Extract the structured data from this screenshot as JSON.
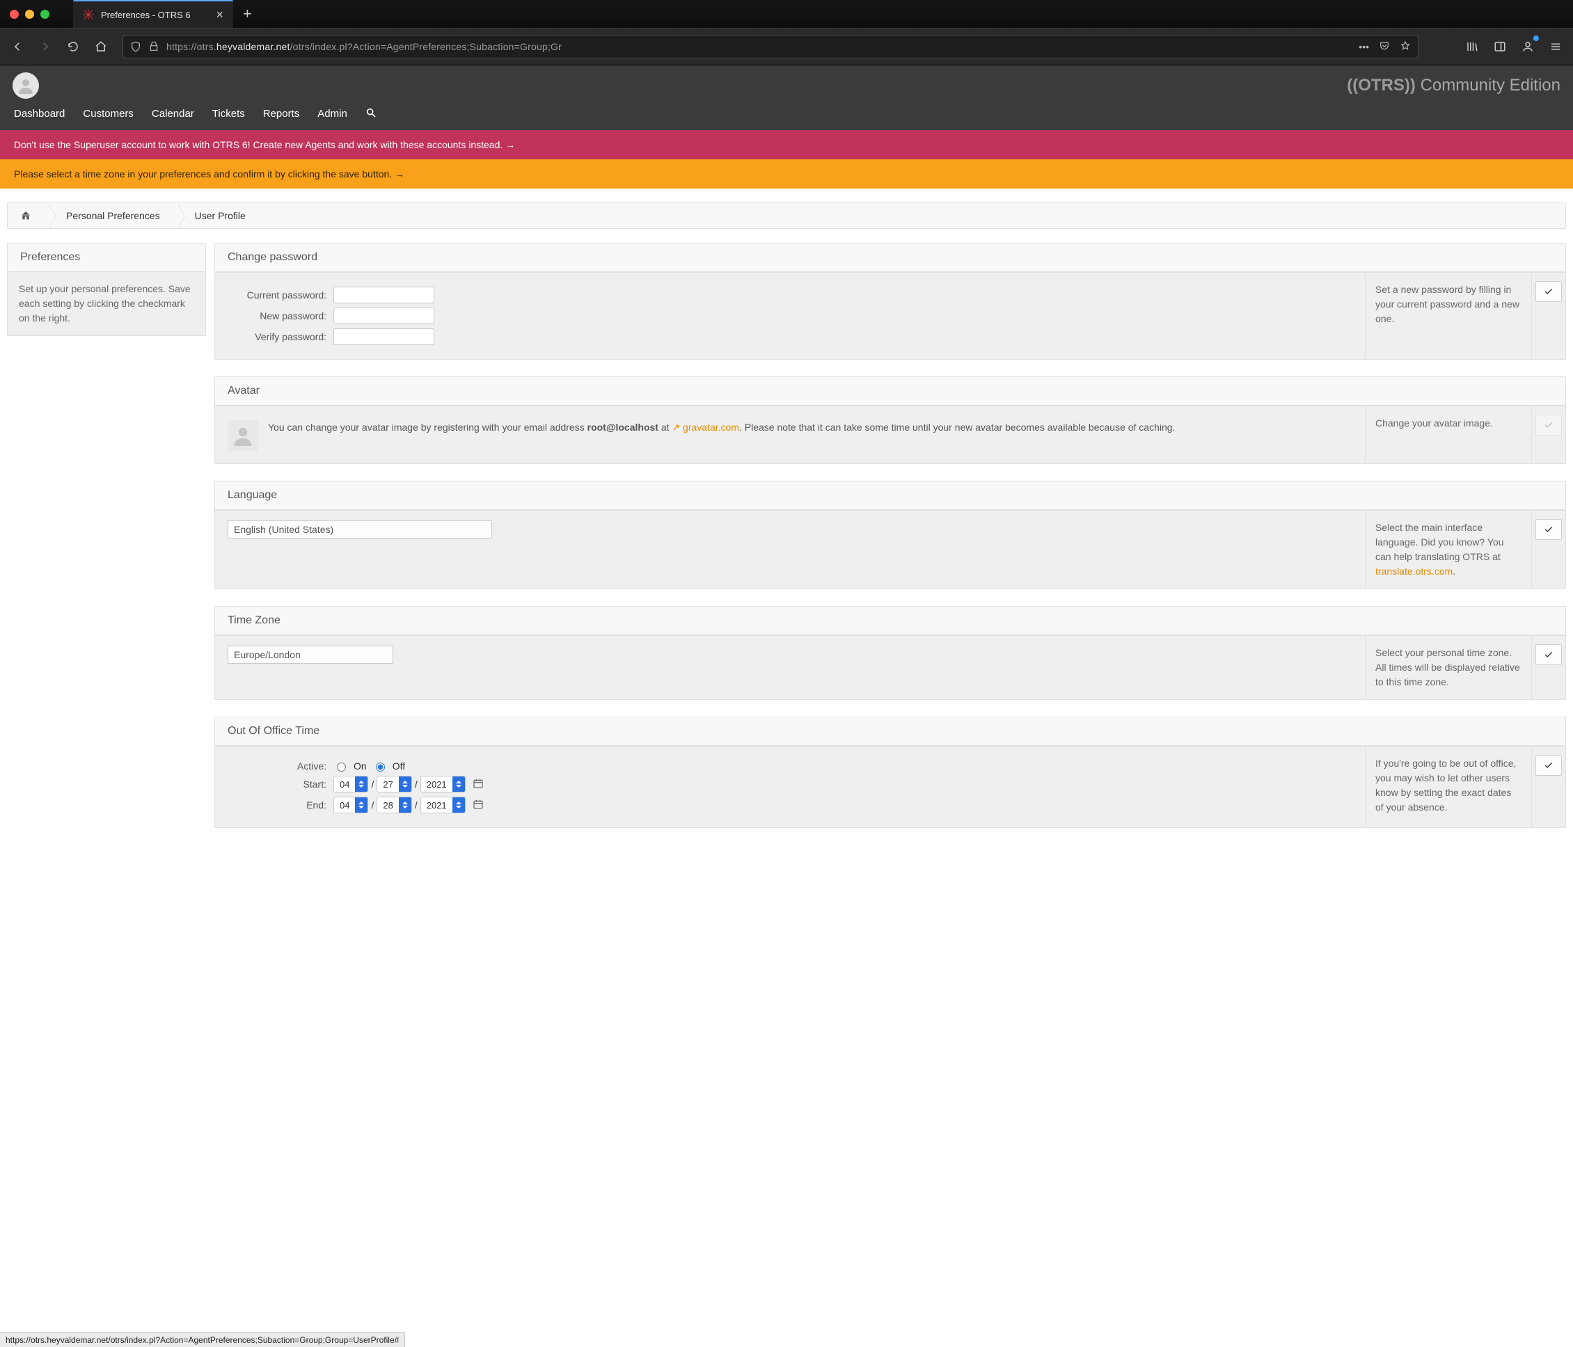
{
  "browser": {
    "tab_title": "Preferences - OTRS 6",
    "url_scheme": "https://otrs.",
    "url_host": "heyvaldemar.net",
    "url_path": "/otrs/index.pl?Action=AgentPreferences;Subaction=Group;Gr"
  },
  "brand": {
    "strong": "((OTRS))",
    "rest": " Community Edition"
  },
  "nav": {
    "items": [
      "Dashboard",
      "Customers",
      "Calendar",
      "Tickets",
      "Reports",
      "Admin"
    ]
  },
  "banners": {
    "red": "Don't use the Superuser account to work with OTRS 6! Create new Agents and work with these accounts instead. →",
    "orange": "Please select a time zone in your preferences and confirm it by clicking the save button. →"
  },
  "crumbs": {
    "a": "Personal Preferences",
    "b": "User Profile"
  },
  "side": {
    "title": "Preferences",
    "text": "Set up your personal preferences. Save each setting by clicking the checkmark on the right."
  },
  "password": {
    "title": "Change password",
    "labels": {
      "current": "Current password:",
      "new": "New password:",
      "verify": "Verify password:"
    },
    "desc": "Set a new password by filling in your current password and a new one."
  },
  "avatar": {
    "title": "Avatar",
    "lead": "You can change your avatar image by registering with your email address ",
    "email": "root@localhost",
    "at": " at ",
    "site": "gravatar.com",
    "tail": ". Please note that it can take some time until your new avatar becomes available because of caching.",
    "desc": "Change your avatar image."
  },
  "language": {
    "title": "Language",
    "value": "English (United States)",
    "desc_a": "Select the main interface language. Did you know? You can help translating OTRS at ",
    "desc_link": "translate.otrs.com",
    "desc_tail": "."
  },
  "timezone": {
    "title": "Time Zone",
    "value": "Europe/London",
    "desc": "Select your personal time zone. All times will be displayed relative to this time zone."
  },
  "ooo": {
    "title": "Out Of Office Time",
    "labels": {
      "active": "Active:",
      "on": "On",
      "off": "Off",
      "start": "Start:",
      "end": "End:"
    },
    "start": {
      "m": "04",
      "d": "27",
      "y": "2021"
    },
    "end": {
      "m": "04",
      "d": "28",
      "y": "2021"
    },
    "desc": "If you're going to be out of office, you may wish to let other users know by setting the exact dates of your absence."
  },
  "status": "https://otrs.heyvaldemar.net/otrs/index.pl?Action=AgentPreferences;Subaction=Group;Group=UserProfile#"
}
